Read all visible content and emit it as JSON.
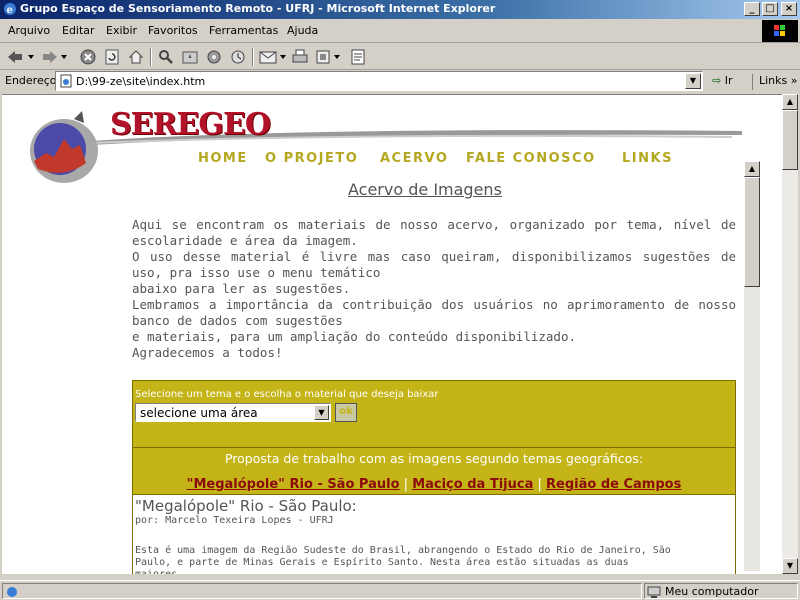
{
  "window": {
    "title": "Grupo Espaço de Sensoriamento Remoto - UFRJ - Microsoft Internet Explorer",
    "controls": {
      "minimize": "_",
      "maximize": "□",
      "close": "×"
    }
  },
  "menubar": [
    "Arquivo",
    "Editar",
    "Exibir",
    "Favoritos",
    "Ferramentas",
    "Ajuda"
  ],
  "toolbar": {
    "icons": [
      "back-icon",
      "forward-icon",
      "stop-icon",
      "refresh-icon",
      "home-icon",
      "search-icon",
      "favorites-icon",
      "media-icon",
      "history-icon",
      "mail-icon",
      "print-icon",
      "edit-icon",
      "discuss-icon"
    ]
  },
  "address": {
    "label": "Endereço",
    "value": "D:\\99-ze\\site\\index.htm",
    "go_label": "Ir",
    "links_label": "Links"
  },
  "page": {
    "brand": "SEREGEO",
    "nav": [
      "HOME",
      "O PROJETO",
      "ACERVO",
      "FALE CONOSCO",
      "LINKS"
    ],
    "section_title": "Acervo de Imagens",
    "intro": [
      "Aqui se encontram os materiais de nosso acervo, organizado por tema, nível de escolaridade e área da imagem.",
      "O uso desse material é livre mas caso queiram, disponibilizamos sugestões de uso, pra isso use o menu temático",
      "abaixo para ler as sugestões.",
      "Lembramos a importância da contribuição dos usuários no aprimoramento de nosso banco de dados com sugestões",
      "e materiais, para um ampliação do conteúdo disponibilizado.",
      "Agradecemos a todos!"
    ],
    "panel": {
      "prompt": "Selecione um tema e o escolha o material que deseja baixar",
      "select_value": "selecione uma área",
      "ok_label": "ok",
      "subtitle": "Proposta de trabalho com as imagens segundo temas geográficos:",
      "links": [
        "\"Megalópole\" Rio - São Paulo",
        "Maciço da Tijuca",
        "Região de Campos"
      ],
      "separator": "|"
    },
    "article": {
      "title": "\"Megalópole\" Rio - São Paulo:",
      "author": "por: Marcelo Texeira Lopes - UFRJ",
      "body": "Esta é uma imagem da Região Sudeste do Brasil, abrangendo o Estado do Rio de Janeiro, São Paulo, e parte de Minas Gerais e Espírito Santo. Nesta área estão situadas as duas maiores"
    }
  },
  "status": {
    "zone": "Meu computador"
  },
  "colors": {
    "titlebar": "#0a246a",
    "accent_olive": "#c4b417",
    "brand_red": "#b3122b",
    "link_red": "#8b0a0a"
  }
}
